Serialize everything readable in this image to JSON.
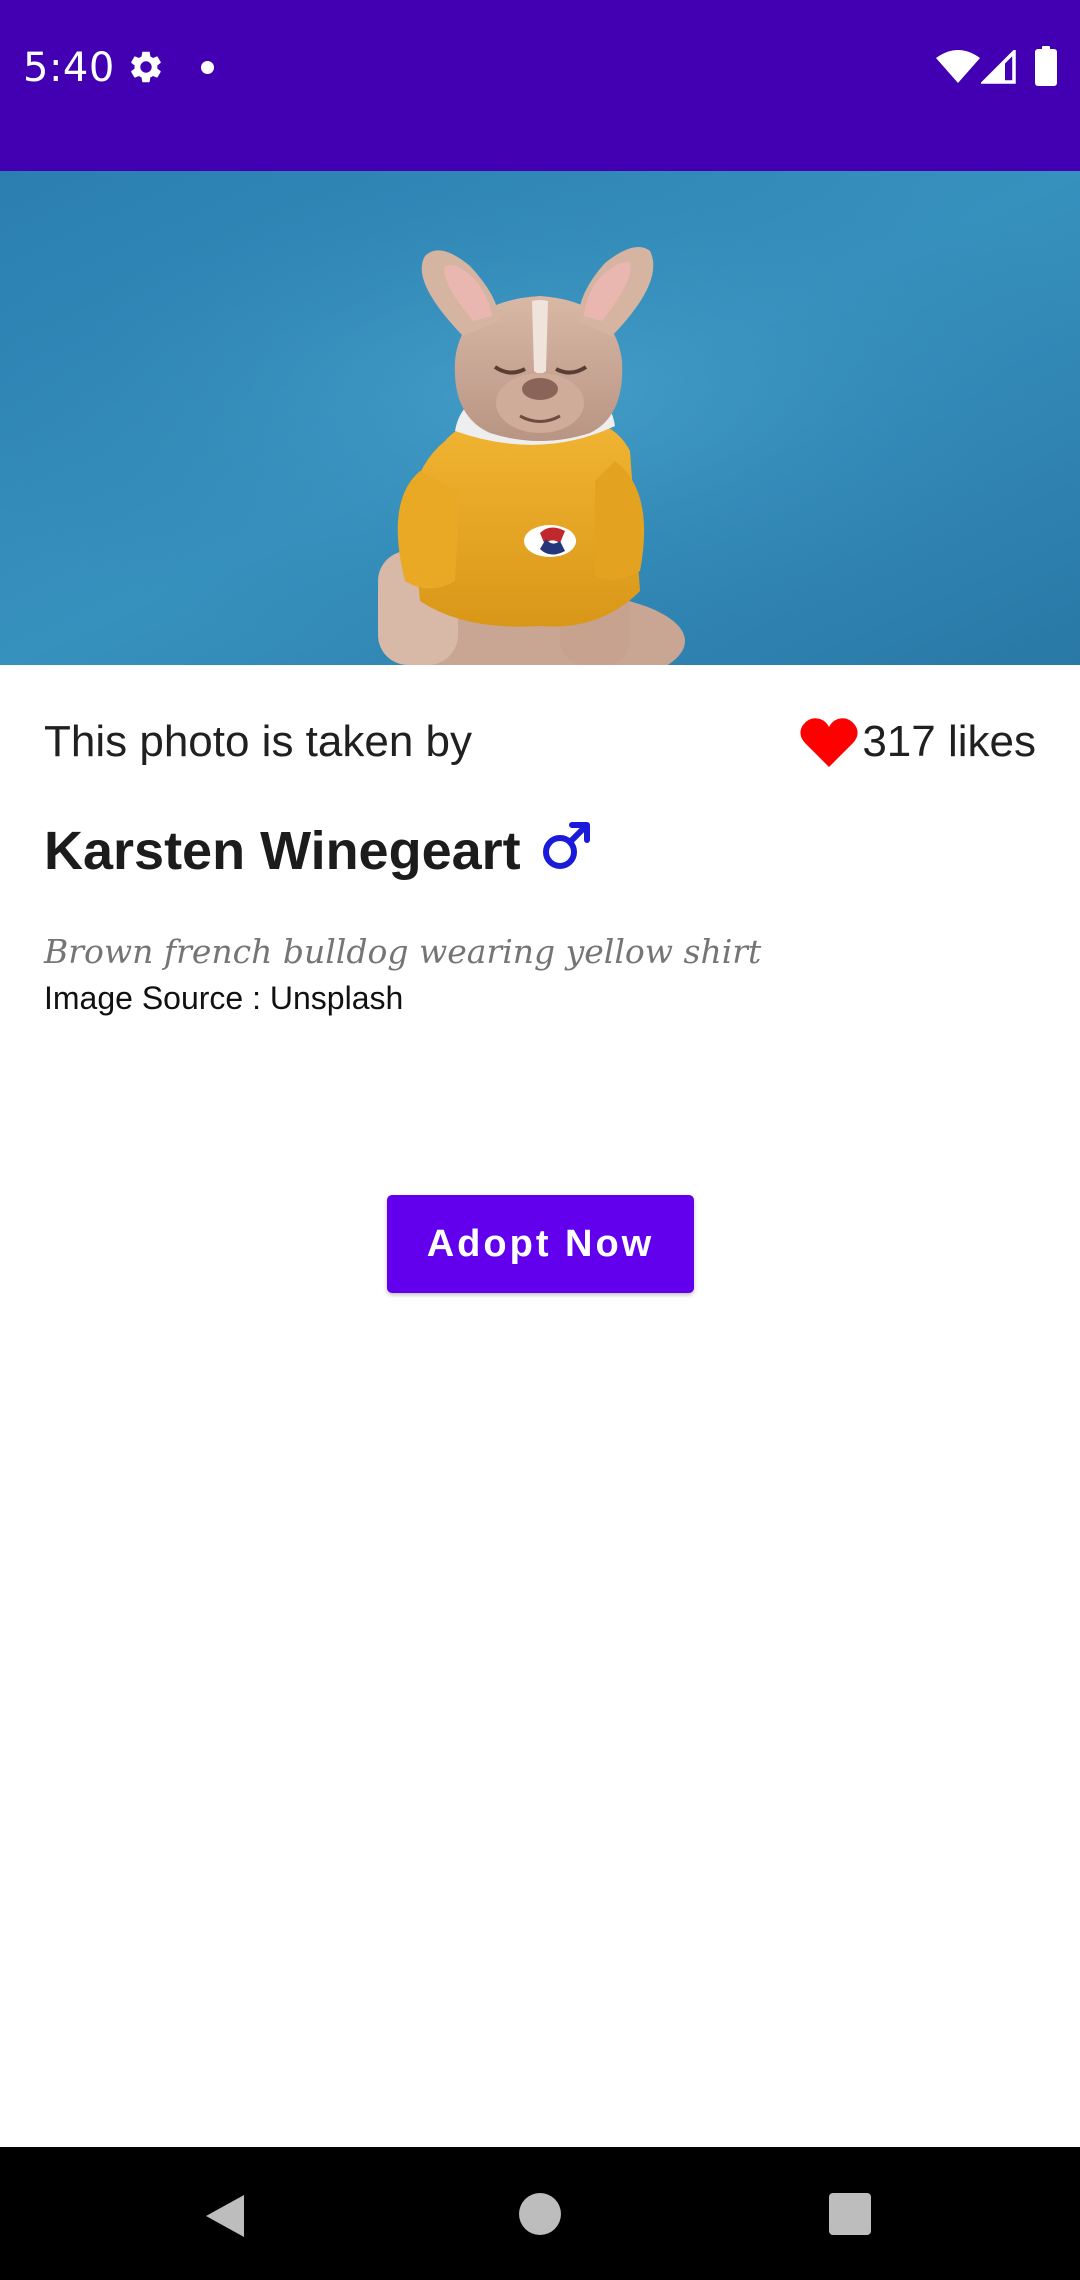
{
  "status_bar": {
    "time": "5:40",
    "icons": [
      "gear-icon",
      "notification-dot-icon",
      "wifi-icon",
      "signal-icon",
      "battery-icon"
    ],
    "background": "#4300b3"
  },
  "hero_image": {
    "subject": "dog-photo",
    "background": "#2f86b0"
  },
  "photo_info": {
    "taken_by_label": "This photo is taken by",
    "likes_text": "317 likes",
    "likes_icon": "heart-icon",
    "heart_color": "#ff0000",
    "author_name": "Karsten Winegeart",
    "gender_icon": "male-icon",
    "gender_color": "#1a1adb",
    "description": "Brown french bulldog wearing yellow shirt",
    "source": "Image Source : Unsplash"
  },
  "actions": {
    "adopt_label": "Adopt Now",
    "accent": "#6200ee"
  },
  "nav_bar": {
    "icons": [
      "back-icon",
      "home-icon",
      "recents-icon"
    ]
  }
}
